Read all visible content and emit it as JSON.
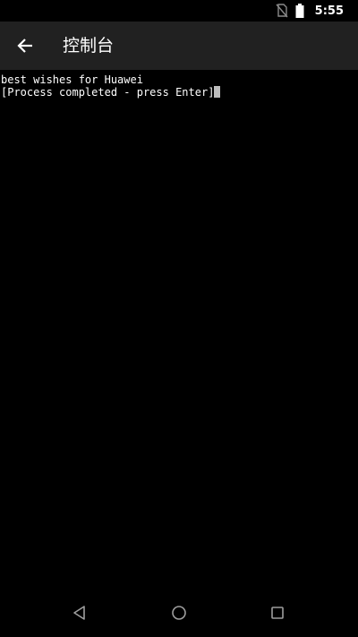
{
  "status_bar": {
    "time": "5:55",
    "icons": [
      "no-sim-icon",
      "battery-icon"
    ]
  },
  "app_bar": {
    "title": "控制台",
    "back_icon": "arrow-left-icon"
  },
  "terminal": {
    "lines": [
      "best wishes for Huawei",
      "[Process completed - press Enter]"
    ]
  },
  "nav_bar": {
    "icons": [
      "nav-back-triangle-icon",
      "nav-home-circle-icon",
      "nav-recent-square-icon"
    ]
  },
  "colors": {
    "app_bar_bg": "#212121",
    "background": "#000000",
    "text": "#ffffff",
    "cursor": "#bdbdbd",
    "nav_icon": "#9e9e9e"
  }
}
